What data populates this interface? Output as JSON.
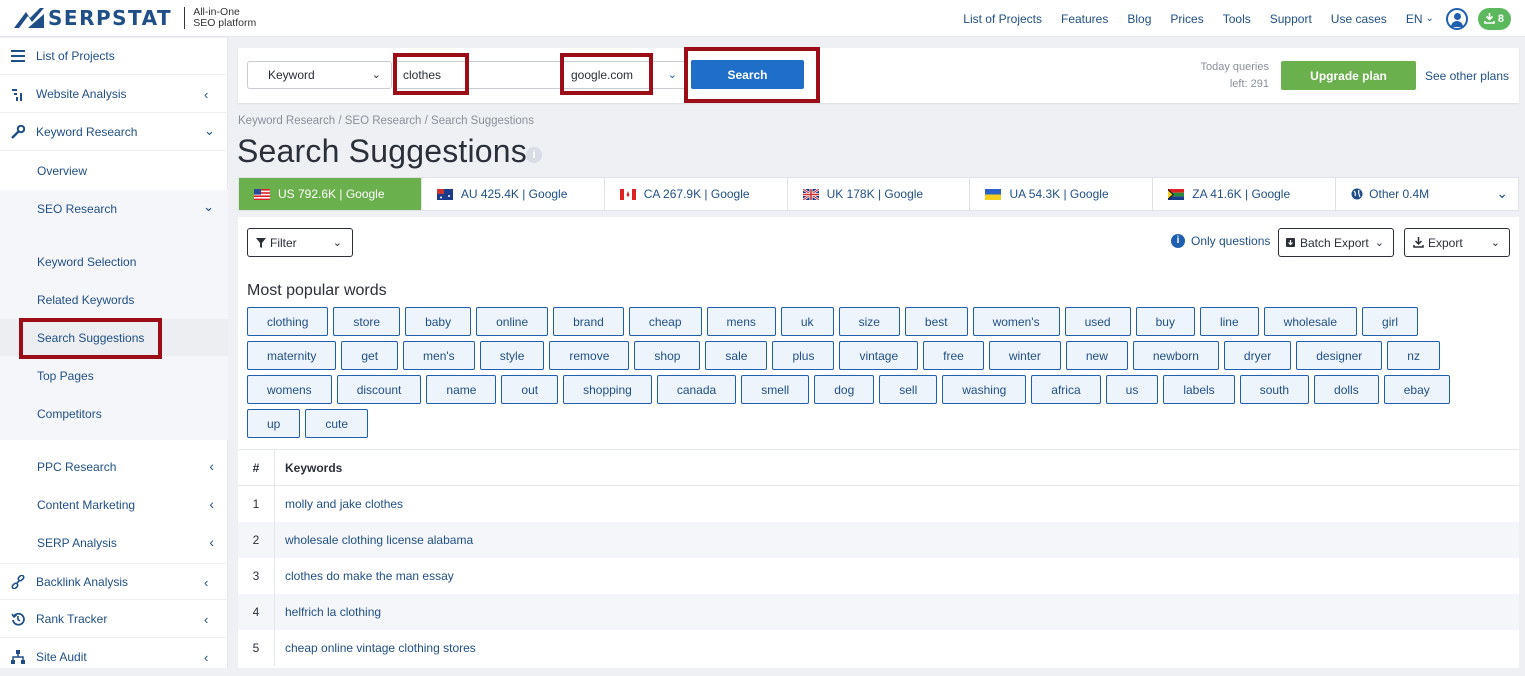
{
  "brand": {
    "name": "SERPSTAT",
    "sub1": "All-in-One",
    "sub2": "SEO platform"
  },
  "topnav": {
    "items": [
      "List of Projects",
      "Features",
      "Blog",
      "Prices",
      "Tools",
      "Support",
      "Use cases"
    ],
    "lang": "EN",
    "downloads": "8"
  },
  "sidebar": {
    "top": [
      {
        "label": "List of Projects",
        "icon": "menu-icon"
      },
      {
        "label": "Website Analysis",
        "icon": "chart-icon"
      },
      {
        "label": "Keyword Research",
        "icon": "key-icon"
      }
    ],
    "kr_sub": [
      "Overview",
      "SEO Research"
    ],
    "seo_sub": [
      "Keyword Selection",
      "Related Keywords",
      "Search Suggestions",
      "Top Pages",
      "Competitors"
    ],
    "kr_more": [
      "PPC Research",
      "Content Marketing",
      "SERP Analysis"
    ],
    "bottom": [
      {
        "label": "Backlink Analysis",
        "icon": "link-icon"
      },
      {
        "label": "Rank Tracker",
        "icon": "history-icon"
      },
      {
        "label": "Site Audit",
        "icon": "sitemap-icon"
      }
    ]
  },
  "search": {
    "type": "Keyword",
    "query": "clothes",
    "database": "google.com",
    "button": "Search",
    "today_label": "Today queries",
    "today_left": "left: 291",
    "upgrade": "Upgrade plan",
    "other_plans": "See other plans"
  },
  "breadcrumb": "Keyword Research / SEO Research / Search Suggestions",
  "page_title": "Search Suggestions",
  "db_tabs": [
    {
      "label": "US 792.6K | Google",
      "flag": "us",
      "active": true
    },
    {
      "label": "AU 425.4K | Google",
      "flag": "au",
      "active": false
    },
    {
      "label": "CA 267.9K | Google",
      "flag": "ca",
      "active": false
    },
    {
      "label": "UK 178K | Google",
      "flag": "uk",
      "active": false
    },
    {
      "label": "UA 54.3K | Google",
      "flag": "ua",
      "active": false
    },
    {
      "label": "ZA 41.6K | Google",
      "flag": "za",
      "active": false
    },
    {
      "label": "Other 0.4M",
      "flag": "globe",
      "active": false
    }
  ],
  "toolbar": {
    "filter": "Filter",
    "only_questions": "Only questions",
    "batch_export": "Batch Export",
    "export": "Export"
  },
  "popular": {
    "title": "Most popular words",
    "words": [
      "clothing",
      "store",
      "baby",
      "online",
      "brand",
      "cheap",
      "mens",
      "uk",
      "size",
      "best",
      "women's",
      "used",
      "buy",
      "line",
      "wholesale",
      "girl",
      "maternity",
      "get",
      "men's",
      "style",
      "remove",
      "shop",
      "sale",
      "plus",
      "vintage",
      "free",
      "winter",
      "new",
      "newborn",
      "dryer",
      "designer",
      "nz",
      "womens",
      "discount",
      "name",
      "out",
      "shopping",
      "canada",
      "smell",
      "dog",
      "sell",
      "washing",
      "africa",
      "us",
      "labels",
      "south",
      "dolls",
      "ebay",
      "up",
      "cute"
    ]
  },
  "table": {
    "col_num": "#",
    "col_kw": "Keywords",
    "rows": [
      {
        "n": "1",
        "kw": "molly and jake clothes"
      },
      {
        "n": "2",
        "kw": "wholesale clothing license alabama"
      },
      {
        "n": "3",
        "kw": "clothes do make the man essay"
      },
      {
        "n": "4",
        "kw": "helfrich la clothing"
      },
      {
        "n": "5",
        "kw": "cheap online vintage clothing stores"
      }
    ]
  }
}
